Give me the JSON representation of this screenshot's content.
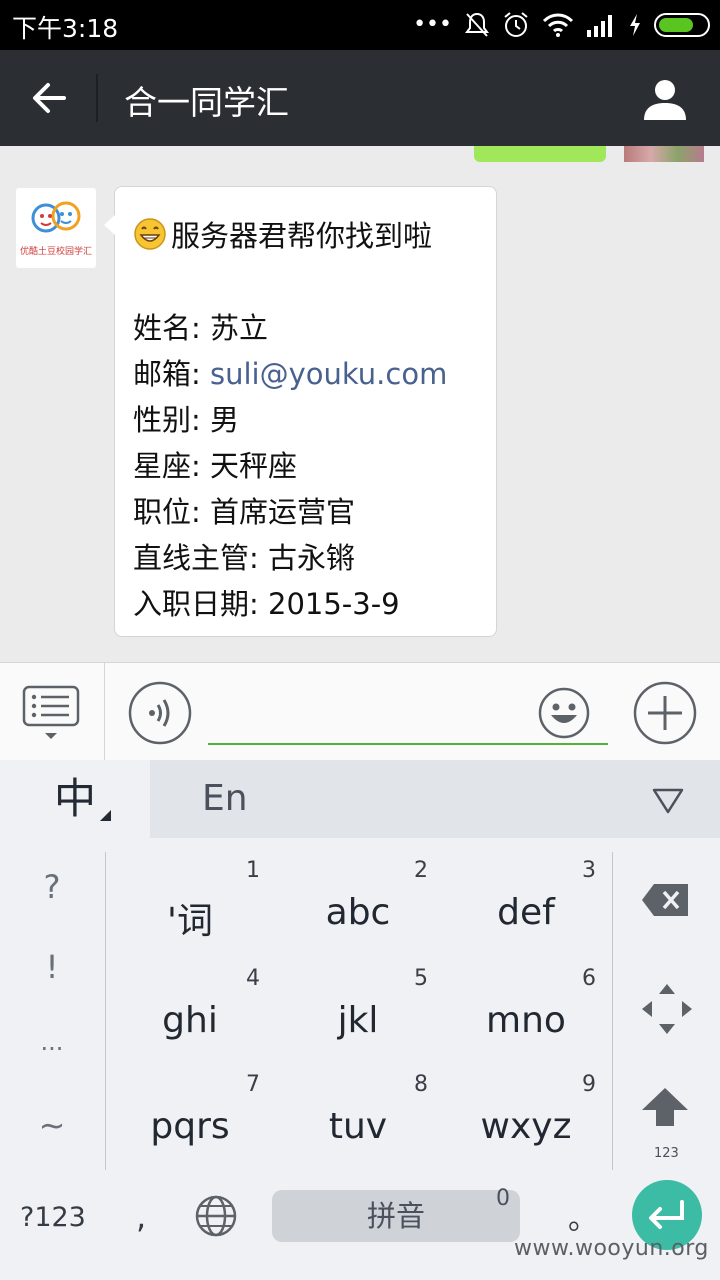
{
  "status_bar": {
    "time": "下午3:18",
    "icons": [
      "more-dots-icon",
      "mute-bell-icon",
      "alarm-icon",
      "wifi-icon",
      "signal-icon",
      "charging-icon",
      "battery-icon"
    ],
    "battery_color": "#5ac421"
  },
  "title_bar": {
    "title": "合一同学汇",
    "back_icon": "back-arrow-icon",
    "profile_icon": "person-icon",
    "background": "#2b2e33"
  },
  "chat": {
    "bot_avatar_text": "优酷土豆校园学汇",
    "message": {
      "title": "服务器君帮你找到啦",
      "rows": [
        {
          "label": "姓名:",
          "value": "苏立"
        },
        {
          "label": "邮箱:",
          "value": "suli@youku.com",
          "link": true
        },
        {
          "label": "性别:",
          "value": "男"
        },
        {
          "label": "星座:",
          "value": "天秤座"
        },
        {
          "label": "职位:",
          "value": "首席运营官"
        },
        {
          "label": "直线主管:",
          "value": "古永锵"
        },
        {
          "label": "入职日期:",
          "value": "2015-3-9"
        }
      ]
    }
  },
  "input_bar": {
    "text_value": "",
    "accent": "#52b23b"
  },
  "keyboard": {
    "mode_zh": "中",
    "mode_en": "En",
    "symbols": [
      "?",
      "!",
      "...",
      "~"
    ],
    "keys": [
      {
        "label": "'词",
        "num": "1"
      },
      {
        "label": "abc",
        "num": "2"
      },
      {
        "label": "def",
        "num": "3"
      },
      {
        "label": "ghi",
        "num": "4"
      },
      {
        "label": "jkl",
        "num": "5"
      },
      {
        "label": "mno",
        "num": "6"
      },
      {
        "label": "pqrs",
        "num": "7"
      },
      {
        "label": "tuv",
        "num": "8"
      },
      {
        "label": "wxyz",
        "num": "9"
      }
    ],
    "shift_label": "123",
    "bottom": {
      "sym_key": "?123",
      "comma": ",",
      "space_label": "拼音",
      "space_num": "0",
      "period": "。"
    },
    "enter_color": "#3cbca4"
  },
  "watermark": "www.wooyun.org"
}
